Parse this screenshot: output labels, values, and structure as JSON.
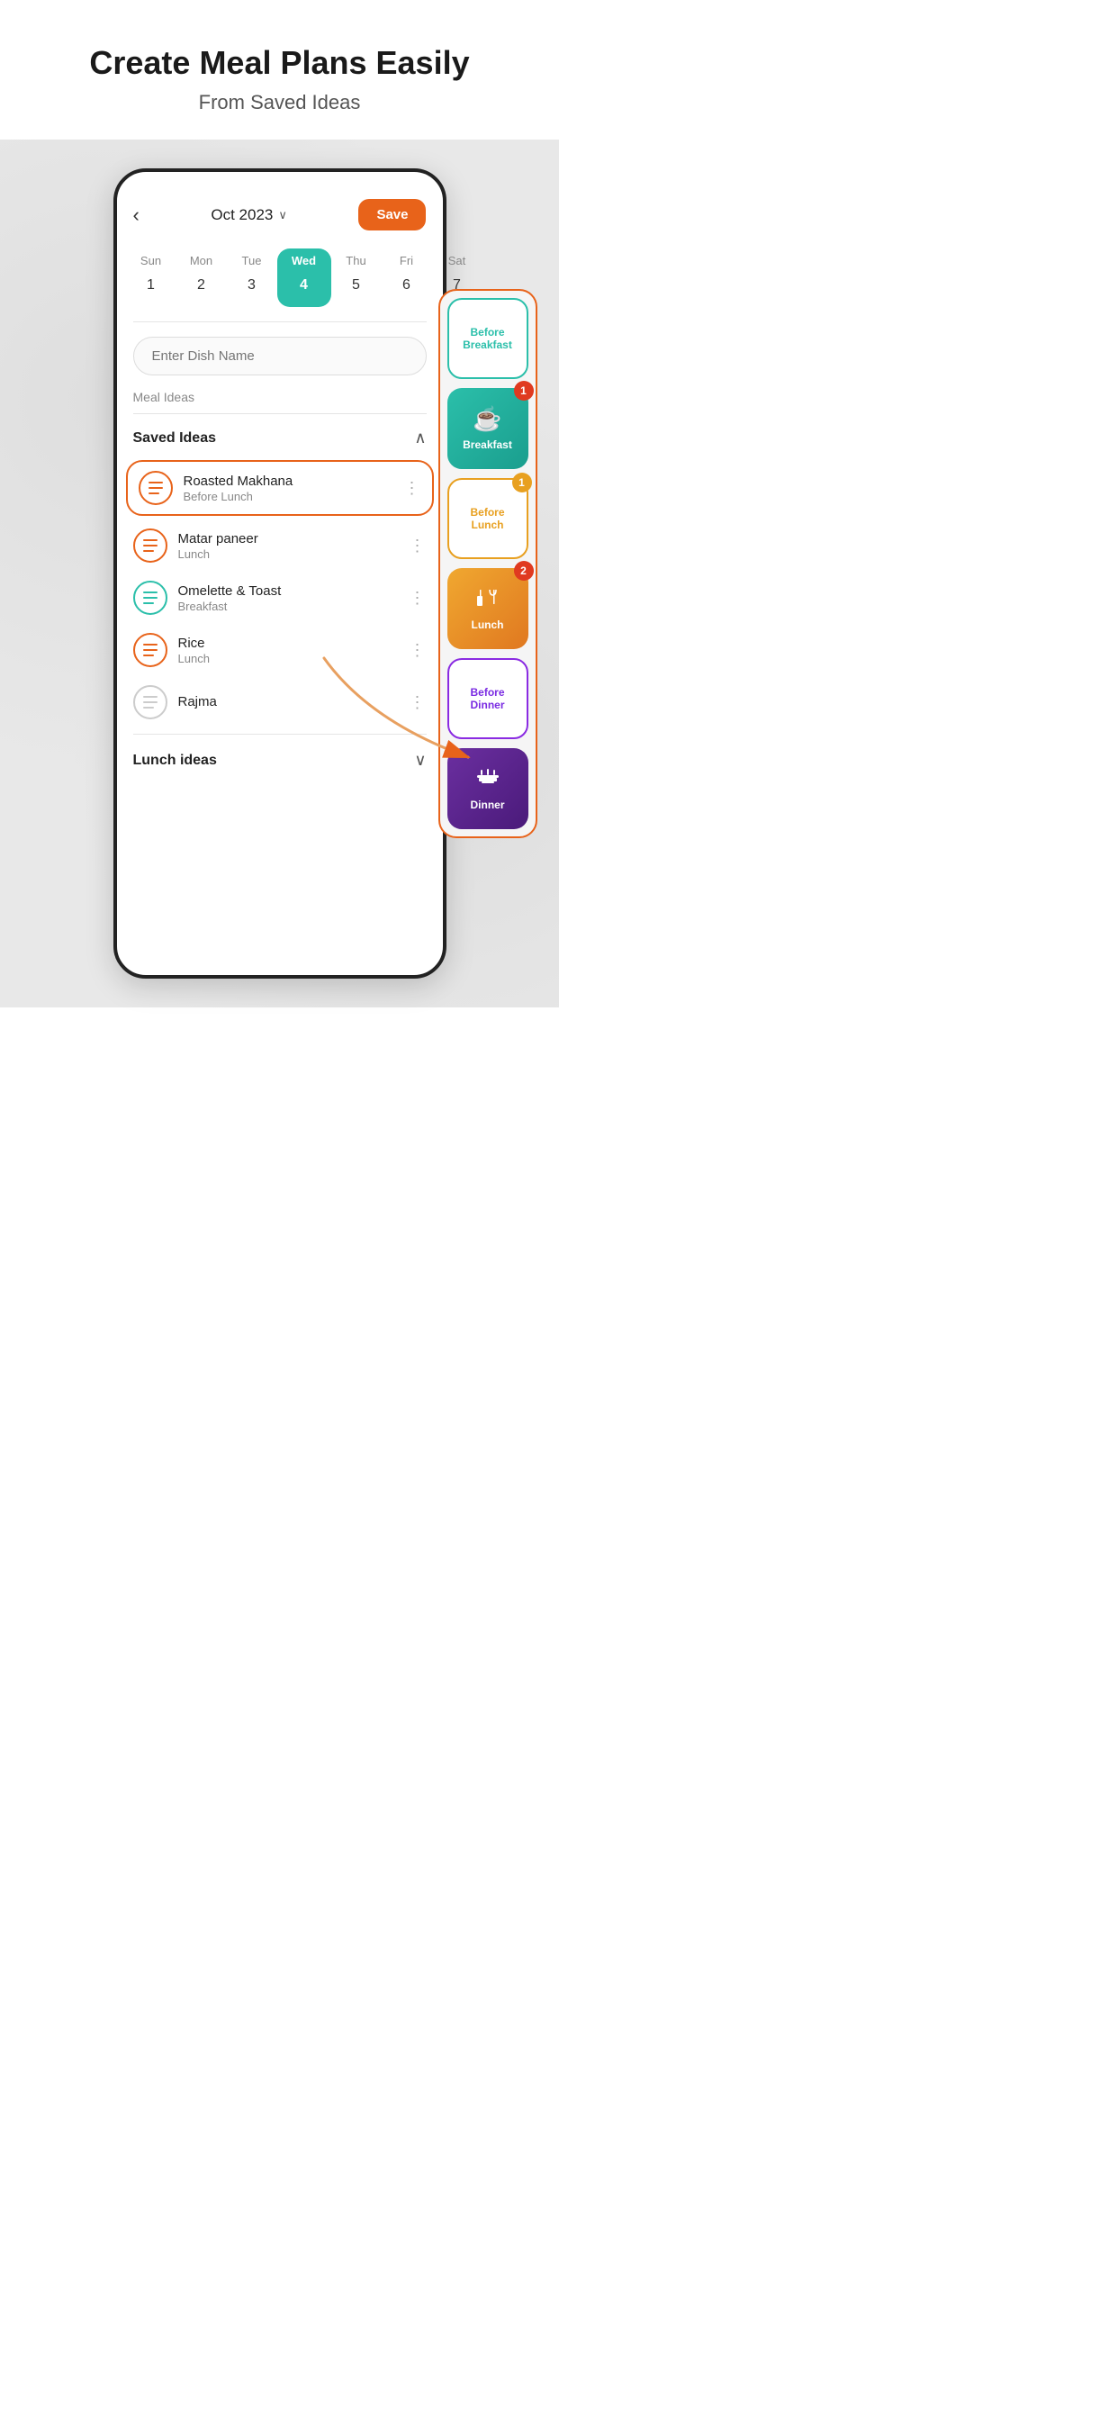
{
  "hero": {
    "title": "Create Meal Plans Easily",
    "subtitle": "From Saved Ideas"
  },
  "app": {
    "back_btn": "‹",
    "month": "Oct 2023",
    "chevron": "∨",
    "save_btn": "Save",
    "dish_input_placeholder": "Enter Dish Name"
  },
  "calendar": {
    "days": [
      {
        "name": "Sun",
        "num": "1",
        "active": false
      },
      {
        "name": "Mon",
        "num": "2",
        "active": false
      },
      {
        "name": "Tue",
        "num": "3",
        "active": false
      },
      {
        "name": "Wed",
        "num": "4",
        "active": true
      },
      {
        "name": "Thu",
        "num": "5",
        "active": false
      },
      {
        "name": "Fri",
        "num": "6",
        "active": false
      },
      {
        "name": "Sat",
        "num": "7",
        "active": false
      }
    ]
  },
  "sections": {
    "meal_ideas_label": "Meal Ideas",
    "saved_ideas_label": "Saved Ideas",
    "collapse_icon": "∧",
    "lunch_ideas_label": "Lunch ideas",
    "expand_icon": "∨"
  },
  "meal_items": [
    {
      "name": "Roasted Makhana",
      "time": "Before Lunch",
      "highlighted": true,
      "color": "#e8631a",
      "border": "#e8631a"
    },
    {
      "name": "Matar paneer",
      "time": "Lunch",
      "highlighted": false,
      "color": "#e8631a",
      "border": "#e8631a"
    },
    {
      "name": "Omelette & Toast",
      "time": "Breakfast",
      "highlighted": false,
      "color": "#2bbfaa",
      "border": "#2bbfaa"
    },
    {
      "name": "Rice",
      "time": "Lunch",
      "highlighted": false,
      "color": "#e8631a",
      "border": "#e8631a"
    },
    {
      "name": "Rajma",
      "time": "",
      "highlighted": false,
      "color": "#ccc",
      "border": "#ccc"
    }
  ],
  "categories": [
    {
      "id": "before-breakfast",
      "label": "Before\nBreakfast",
      "type": "before-breakfast",
      "badge": null,
      "icon": null
    },
    {
      "id": "breakfast",
      "label": "Breakfast",
      "type": "breakfast",
      "badge": "1",
      "badge_color": "red",
      "icon": "☕"
    },
    {
      "id": "before-lunch",
      "label": "Before\nLunch",
      "type": "before-lunch",
      "badge": "1",
      "badge_color": "orange",
      "icon": null
    },
    {
      "id": "lunch",
      "label": "Lunch",
      "type": "lunch",
      "badge": "2",
      "badge_color": "red",
      "icon": "🍽"
    },
    {
      "id": "before-dinner",
      "label": "Before\nDinner",
      "type": "before-dinner",
      "badge": null,
      "icon": null
    },
    {
      "id": "dinner",
      "label": "Dinner",
      "type": "dinner",
      "badge": null,
      "icon": "🍽"
    }
  ],
  "colors": {
    "teal": "#2bbfaa",
    "orange": "#e8631a",
    "amber": "#e8a020",
    "purple": "#6b2fa0",
    "bg": "#e8e8e8"
  }
}
